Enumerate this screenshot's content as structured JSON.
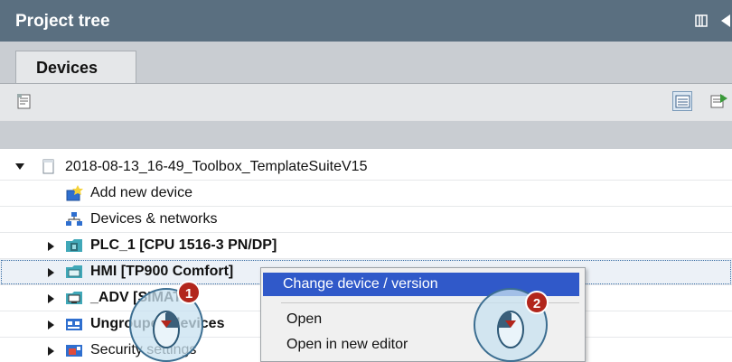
{
  "header": {
    "title": "Project tree"
  },
  "tabs": [
    {
      "label": "Devices"
    }
  ],
  "tree": {
    "rows": [
      {
        "label": "2018-08-13_16-49_Toolbox_TemplateSuiteV15",
        "expander": "down",
        "icon": "project-icon",
        "bold": false
      },
      {
        "label": "Add new device",
        "expander": "none",
        "icon": "add-device-icon",
        "bold": false
      },
      {
        "label": "Devices & networks",
        "expander": "none",
        "icon": "network-icon",
        "bold": false
      },
      {
        "label": "PLC_1 [CPU 1516-3 PN/DP]",
        "expander": "right",
        "icon": "plc-icon",
        "bold": true
      },
      {
        "label": "HMI [TP900 Comfort]",
        "expander": "right",
        "icon": "hmi-icon",
        "bold": true
      },
      {
        "label": "_ADV [SIMATIC",
        "expander": "right",
        "icon": "pc-icon",
        "bold": true
      },
      {
        "label": "Ungrouped devices",
        "expander": "right",
        "icon": "ungrouped-icon",
        "bold": true
      },
      {
        "label": "Security settings",
        "expander": "right",
        "icon": "security-icon",
        "bold": false
      }
    ]
  },
  "context_menu": {
    "items": [
      {
        "label": "Change device / version",
        "highlighted": true
      },
      {
        "label": "Open",
        "highlighted": false
      },
      {
        "label": "Open in new editor",
        "highlighted": false
      }
    ]
  },
  "steps": [
    {
      "number": "1"
    },
    {
      "number": "2"
    }
  ],
  "colors": {
    "header_bg": "#5a6f80",
    "highlight": "#3059c9",
    "badge": "#b2261c"
  }
}
